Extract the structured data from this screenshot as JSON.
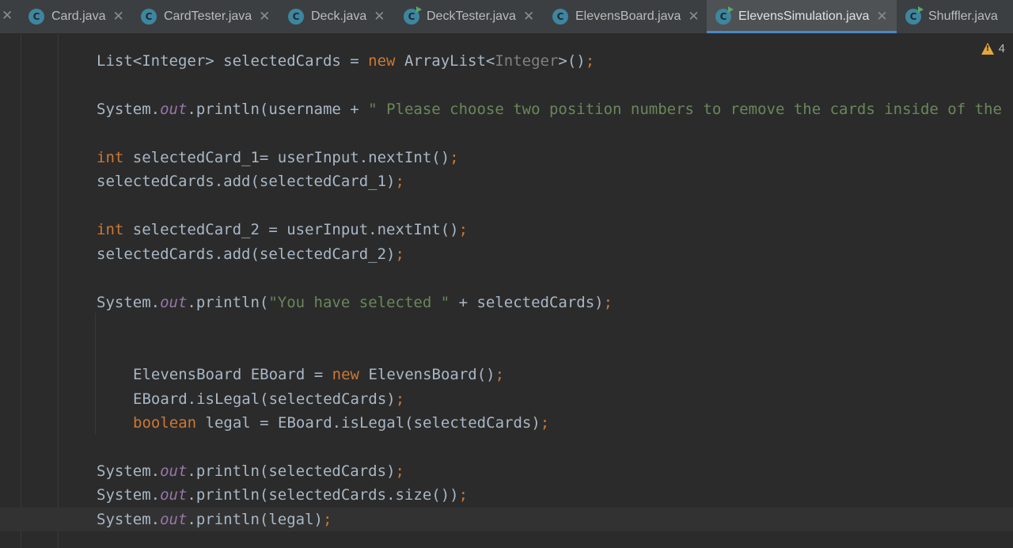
{
  "tabs": [
    {
      "name": "Card.java",
      "icon": "java-class-icon",
      "active": false
    },
    {
      "name": "CardTester.java",
      "icon": "java-class-icon",
      "active": false
    },
    {
      "name": "Deck.java",
      "icon": "java-class-icon",
      "active": false
    },
    {
      "name": "DeckTester.java",
      "icon": "java-runnable-class-icon",
      "active": false
    },
    {
      "name": "ElevensBoard.java",
      "icon": "java-class-icon",
      "active": false
    },
    {
      "name": "ElevensSimulation.java",
      "icon": "java-runnable-class-icon",
      "active": true
    },
    {
      "name": "Shuffler.java",
      "icon": "java-runnable-class-icon",
      "active": false
    }
  ],
  "tab_icon_letter": "C",
  "close_glyph": "✕",
  "warnings": {
    "count": "4",
    "icon": "warning-triangle-icon"
  },
  "colors": {
    "background": "#2b2b2b",
    "tabbar": "#3c3f41",
    "active_tab_underline": "#4a88c7",
    "keyword": "#cc7832",
    "field": "#9876aa",
    "string": "#6a8759",
    "plain": "#a9b7c6"
  },
  "code": {
    "l1": {
      "a": "List<Integer> selectedCards = ",
      "kw": "new",
      "b": " ArrayList<",
      "gen": "Integer",
      "c": ">()",
      "semi": ";"
    },
    "l2": {
      "a": "System.",
      "fld": "out",
      "b": ".println(username + ",
      "str": "\" Please choose two position numbers to remove the cards inside of the"
    },
    "l3": {
      "kw": "int",
      "a": " selectedCard_1= userInput.nextInt()",
      "semi": ";"
    },
    "l4": {
      "a": "selectedCards.add(selectedCard_1)",
      "semi": ";"
    },
    "l5": {
      "kw": "int",
      "a": " selectedCard_2 = userInput.nextInt()",
      "semi": ";"
    },
    "l6": {
      "a": "selectedCards.add(selectedCard_2)",
      "semi": ";"
    },
    "l7": {
      "a": "System.",
      "fld": "out",
      "b": ".println(",
      "str": "\"You have selected \"",
      "c": " + selectedCards)",
      "semi": ";"
    },
    "l8": {
      "a": "ElevensBoard EBoard = ",
      "kw": "new",
      "b": " ElevensBoard()",
      "semi": ";"
    },
    "l9": {
      "a": "EBoard.isLegal(selectedCards)",
      "semi": ";"
    },
    "l10": {
      "kw": "boolean",
      "a": " legal = EBoard.isLegal(selectedCards)",
      "semi": ";"
    },
    "l11": {
      "a": "System.",
      "fld": "out",
      "b": ".println(selectedCards)",
      "semi": ";"
    },
    "l12": {
      "a": "System.",
      "fld": "out",
      "b": ".println(selectedCards.size())",
      "semi": ";"
    },
    "l13": {
      "a": "System.",
      "fld": "out",
      "b": ".println(legal)",
      "semi": ";"
    }
  }
}
